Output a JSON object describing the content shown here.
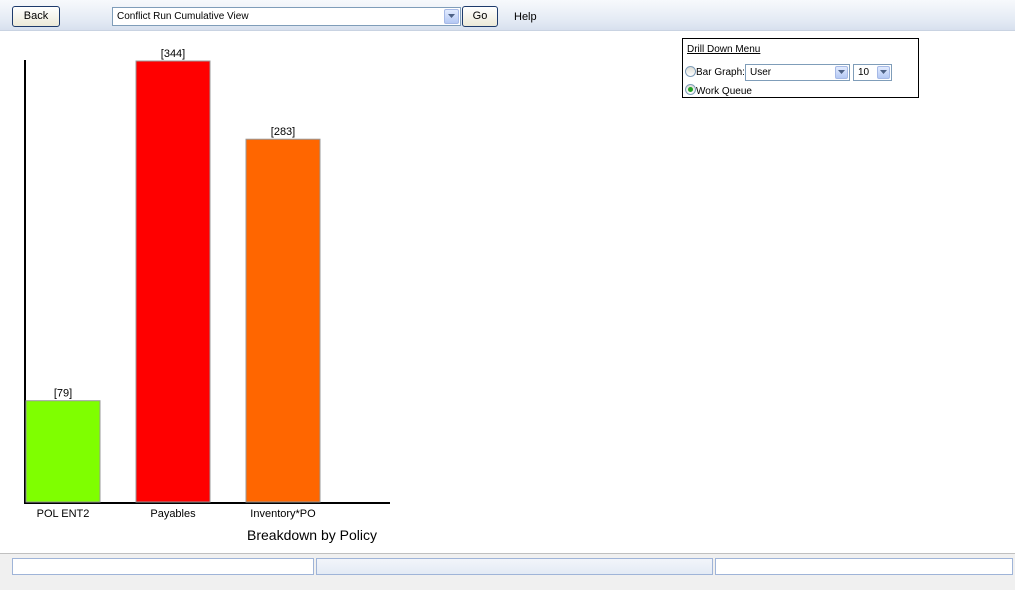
{
  "toolbar": {
    "back_label": "Back",
    "view_selected": "Conflict Run Cumulative View",
    "go_label": "Go",
    "help_label": "Help"
  },
  "drill_menu": {
    "title": "Drill Down Menu",
    "bar_graph_label": "Bar Graph:",
    "bar_graph_selected": "User",
    "count_selected": "10",
    "work_queue_label": "Work Queue",
    "selected_option": "work_queue"
  },
  "chart_data": {
    "type": "bar",
    "categories": [
      "POL ENT2",
      "Payables",
      "Inventory*PO"
    ],
    "values": [
      79,
      344,
      283
    ],
    "value_labels": [
      "[79]",
      "[344]",
      "[283]"
    ],
    "colors": [
      "#7fff00",
      "#ff0000",
      "#ff6600"
    ],
    "xlabel": "Breakdown by Policy",
    "ylim": [
      0,
      344
    ]
  }
}
